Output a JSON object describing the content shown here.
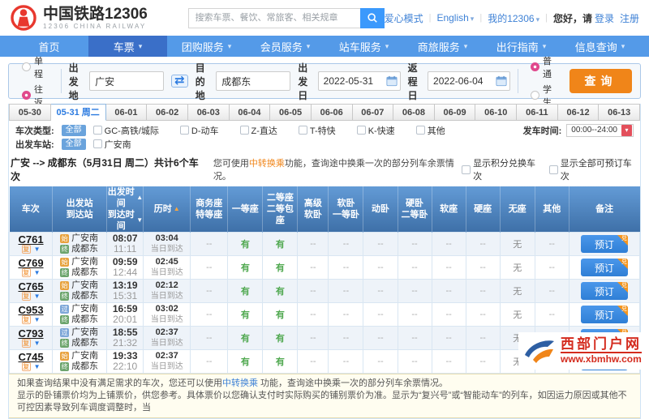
{
  "header": {
    "logo_title": "中国铁路12306",
    "logo_subtitle": "12306 CHINA RAILWAY",
    "search_placeholder": "搜索车票、餐饮、常旅客、相关规章",
    "love_mode": "爱心模式",
    "language": "English",
    "my12306": "我的12306",
    "greeting": "您好，请",
    "login": "登录",
    "register": "注册"
  },
  "nav": [
    {
      "label": "首页",
      "active": false,
      "dropdown": false
    },
    {
      "label": "车票",
      "active": true,
      "dropdown": true
    },
    {
      "label": "团购服务",
      "active": false,
      "dropdown": true
    },
    {
      "label": "会员服务",
      "active": false,
      "dropdown": true
    },
    {
      "label": "站车服务",
      "active": false,
      "dropdown": true
    },
    {
      "label": "商旅服务",
      "active": false,
      "dropdown": true
    },
    {
      "label": "出行指南",
      "active": false,
      "dropdown": true
    },
    {
      "label": "信息查询",
      "active": false,
      "dropdown": true
    }
  ],
  "query": {
    "trip_types": [
      {
        "label": "单程",
        "checked": false
      },
      {
        "label": "往返",
        "checked": true
      }
    ],
    "from_label": "出发地",
    "from_value": "广安",
    "to_label": "目的地",
    "to_value": "成都东",
    "depart_label": "出发日",
    "depart_value": "2022-05-31",
    "return_label": "返程日",
    "return_value": "2022-06-04",
    "passenger_types": [
      {
        "label": "普通",
        "checked": true
      },
      {
        "label": "学生",
        "checked": false
      }
    ],
    "submit_label": "查询"
  },
  "date_tabs": {
    "items": [
      "05-30",
      "05-31 周二",
      "06-01",
      "06-02",
      "06-03",
      "06-04",
      "06-05",
      "06-06",
      "06-07",
      "06-08",
      "06-09",
      "06-10",
      "06-11",
      "06-12",
      "06-13"
    ],
    "active_index": 1
  },
  "filters": {
    "type_label": "车次类型:",
    "type_all": "全部",
    "types": [
      "GC-高铁/城际",
      "D-动车",
      "Z-直达",
      "T-特快",
      "K-快速",
      "其他"
    ],
    "time_label": "发车时间:",
    "time_value": "00:00--24:00",
    "station_label": "出发车站:",
    "station_all": "全部",
    "stations": [
      "广安南"
    ]
  },
  "summary": {
    "route_text": "广安 --> 成都东（5月31日 周二）共计6个车次",
    "tip_prefix": "您可使用",
    "tip_link": "中转换乘",
    "tip_suffix": "功能，查询途中换乘一次的部分列车余票情况。",
    "toggles": [
      "显示积分兑换车次",
      "显示全部可预订车次"
    ]
  },
  "table": {
    "headers": [
      {
        "l1": "车次"
      },
      {
        "l1": "出发站",
        "l2": "到达站"
      },
      {
        "l1": "出发时间",
        "a1": "▲",
        "l2": "到达时间",
        "a2": "▼"
      },
      {
        "l1": "历时",
        "a1": "▲",
        "orange": true
      },
      {
        "l1": "商务座",
        "l2": "特等座"
      },
      {
        "l1": "一等座"
      },
      {
        "l1": "二等座",
        "l2": "二等包座"
      },
      {
        "l1": "高级",
        "l2": "软卧"
      },
      {
        "l1": "软卧",
        "l2": "一等卧"
      },
      {
        "l1": "动卧"
      },
      {
        "l1": "硬卧",
        "l2": "二等卧"
      },
      {
        "l1": "软座"
      },
      {
        "l1": "硬座"
      },
      {
        "l1": "无座"
      },
      {
        "l1": "其他"
      },
      {
        "l1": "备注"
      }
    ],
    "rows": [
      {
        "train": "C761",
        "badge": "复",
        "from_icon": "始",
        "from": "广安南",
        "to_icon": "终",
        "to": "成都东",
        "dep": "08:07",
        "arr": "11:11",
        "dur": "03:04",
        "day": "当日到达",
        "seats": [
          "--",
          "有",
          "有",
          "--",
          "--",
          "--",
          "--",
          "--",
          "--",
          "无",
          "--"
        ],
        "book": "预订",
        "corner": "兑"
      },
      {
        "train": "C769",
        "badge": "复",
        "from_icon": "始",
        "from": "广安南",
        "to_icon": "终",
        "to": "成都东",
        "dep": "09:59",
        "arr": "12:44",
        "dur": "02:45",
        "day": "当日到达",
        "seats": [
          "--",
          "有",
          "有",
          "--",
          "--",
          "--",
          "--",
          "--",
          "--",
          "无",
          "--"
        ],
        "book": "预订",
        "corner": "兑"
      },
      {
        "train": "C765",
        "badge": "复",
        "from_icon": "始",
        "from": "广安南",
        "to_icon": "终",
        "to": "成都东",
        "dep": "13:19",
        "arr": "15:31",
        "dur": "02:12",
        "day": "当日到达",
        "seats": [
          "--",
          "有",
          "有",
          "--",
          "--",
          "--",
          "--",
          "--",
          "--",
          "无",
          "--"
        ],
        "book": "预订",
        "corner": "兑"
      },
      {
        "train": "C953",
        "badge": "复",
        "from_icon": "过",
        "from": "广安南",
        "to_icon": "终",
        "to": "成都东",
        "dep": "16:59",
        "arr": "20:01",
        "dur": "03:02",
        "day": "当日到达",
        "seats": [
          "--",
          "有",
          "有",
          "--",
          "--",
          "--",
          "--",
          "--",
          "--",
          "无",
          "--"
        ],
        "book": "预订",
        "corner": "兑"
      },
      {
        "train": "C793",
        "badge": "复",
        "from_icon": "过",
        "from": "广安南",
        "to_icon": "终",
        "to": "成都东",
        "dep": "18:55",
        "arr": "21:32",
        "dur": "02:37",
        "day": "当日到达",
        "seats": [
          "--",
          "有",
          "有",
          "--",
          "--",
          "--",
          "--",
          "--",
          "--",
          "无",
          "--"
        ],
        "book": "预订",
        "corner": "兑"
      },
      {
        "train": "C745",
        "badge": "复",
        "from_icon": "始",
        "from": "广安南",
        "to_icon": "终",
        "to": "成都东",
        "dep": "19:33",
        "arr": "22:10",
        "dur": "02:37",
        "day": "当日到达",
        "seats": [
          "--",
          "有",
          "有",
          "--",
          "--",
          "--",
          "--",
          "--",
          "--",
          "无",
          "--"
        ],
        "book": "预订",
        "corner": "兑"
      }
    ]
  },
  "notice": {
    "line1_prefix": "如果查询结果中没有满足需求的车次，您还可以使用",
    "line1_link": "中转换乘",
    "line1_suffix": " 功能，查询途中换乘一次的部分列车余票情况。",
    "line2": "显示的卧铺票价均为上铺票价，供您参考。具体票价以您确认支付时实际购买的铺别票价为准。显示为“复兴号”或“智能动车”的列车，如因运力原因或其他不可控因素导致列车调度调整时，当"
  },
  "watermark": {
    "name": "西部门户网",
    "site": "www.xbmhw.com"
  }
}
